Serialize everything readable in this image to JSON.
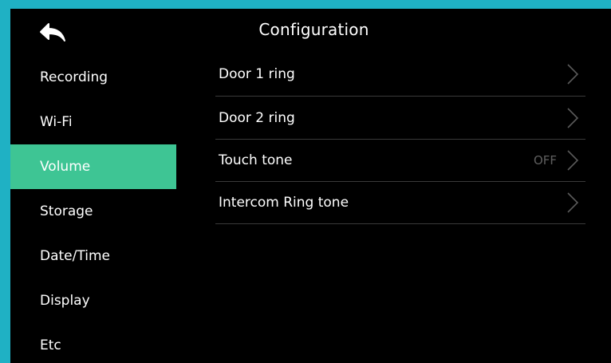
{
  "header": {
    "title": "Configuration",
    "back_icon": "back-arrow-icon"
  },
  "sidebar": {
    "items": [
      {
        "label": "Recording",
        "active": false
      },
      {
        "label": "Wi-Fi",
        "active": false
      },
      {
        "label": "Volume",
        "active": true
      },
      {
        "label": "Storage",
        "active": false
      },
      {
        "label": "Date/Time",
        "active": false
      },
      {
        "label": "Display",
        "active": false
      },
      {
        "label": "Etc",
        "active": false
      }
    ]
  },
  "settings": {
    "rows": [
      {
        "label": "Door 1 ring",
        "value": "",
        "icon": "chevron-right-icon"
      },
      {
        "label": "Door 2 ring",
        "value": "",
        "icon": "chevron-right-icon"
      },
      {
        "label": "Touch tone",
        "value": "OFF",
        "icon": "chevron-right-icon"
      },
      {
        "label": "Intercom Ring tone",
        "value": "",
        "icon": "chevron-right-icon"
      }
    ]
  },
  "colors": {
    "bezel": "#1fb1c4",
    "background": "#000000",
    "active_item": "#3ec594",
    "divider": "#3a3a3a",
    "muted_value": "#5f5f5f"
  }
}
